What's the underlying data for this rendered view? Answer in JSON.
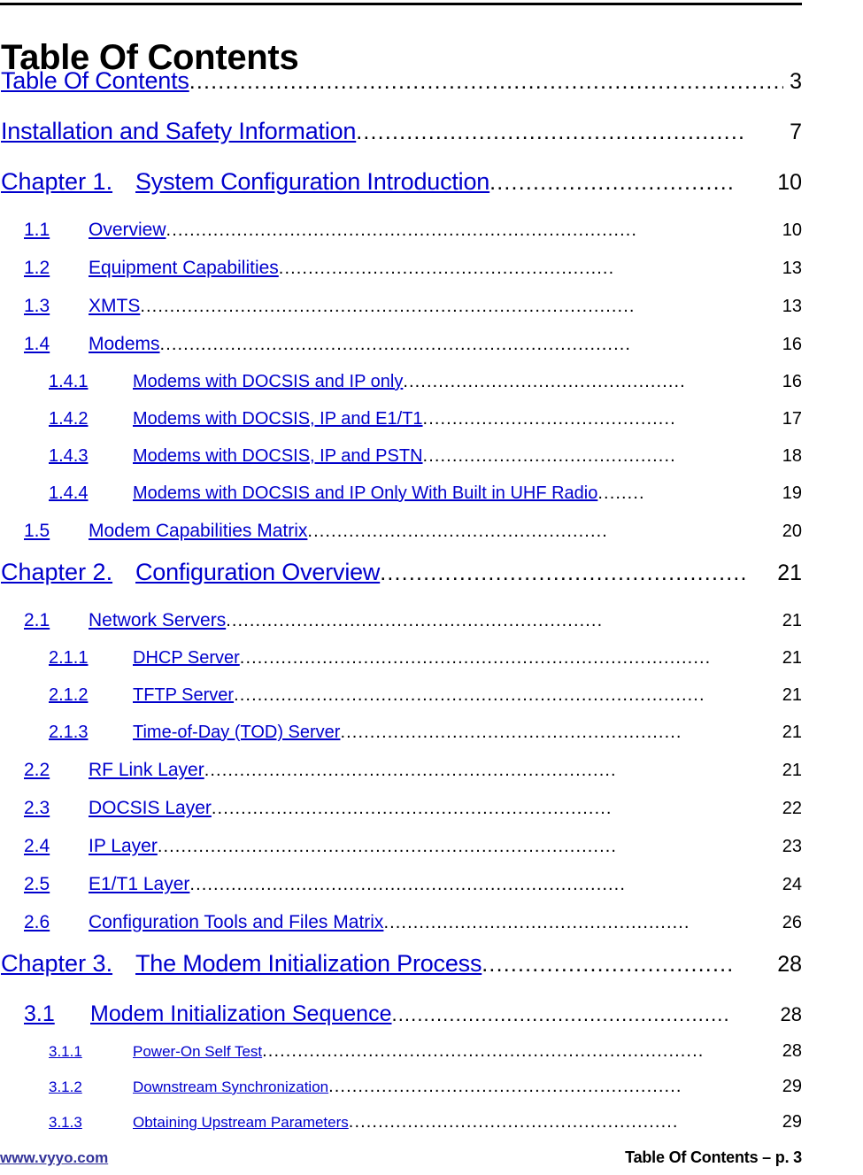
{
  "document": {
    "title": "Table Of Contents",
    "link_color": "#0000cc",
    "footer_url_color": "#333399",
    "text_color": "#000000"
  },
  "toc": {
    "entries": [
      {
        "level": "top",
        "number": "",
        "title": "Table Of Contents",
        "leader": "....................................................................................",
        "page": "3"
      },
      {
        "level": "top",
        "number": "",
        "title": "Installation and Safety Information ",
        "leader": "......................................................",
        "page": "7"
      },
      {
        "level": "chapter",
        "number": "Chapter 1.",
        "title": "System Configuration Introduction",
        "leader": "..................................",
        "page": "10"
      },
      {
        "level": "sub1",
        "number": "1.1",
        "title": "Overview",
        "leader": "................................................................................",
        "page": "10"
      },
      {
        "level": "sub1",
        "number": "1.2",
        "title": "Equipment Capabilities ",
        "leader": ".........................................................",
        "page": "13"
      },
      {
        "level": "sub1",
        "number": "1.3",
        "title": "XMTS",
        "leader": "....................................................................................",
        "page": "13"
      },
      {
        "level": "sub1",
        "number": "1.4",
        "title": "Modems",
        "leader": "................................................................................",
        "page": "16"
      },
      {
        "level": "sub2",
        "number": "1.4.1",
        "title": "Modems with DOCSIS and IP only",
        "leader": "................................................",
        "page": "16"
      },
      {
        "level": "sub2",
        "number": "1.4.2",
        "title": "Modems with DOCSIS, IP and E1/T1",
        "leader": "...........................................",
        "page": "17"
      },
      {
        "level": "sub2",
        "number": "1.4.3",
        "title": "Modems with DOCSIS, IP and PSTN",
        "leader": "...........................................",
        "page": "18"
      },
      {
        "level": "sub2",
        "number": "1.4.4",
        "title": "Modems with DOCSIS and IP Only With Built in UHF Radio ",
        "leader": "........",
        "page": "19"
      },
      {
        "level": "sub1",
        "number": "1.5",
        "title": "Modem Capabilities Matrix ",
        "leader": "...................................................",
        "page": "20"
      },
      {
        "level": "chapter",
        "number": "Chapter 2.",
        "title": "Configuration Overview",
        "leader": "...................................................",
        "page": "21"
      },
      {
        "level": "sub1",
        "number": "2.1",
        "title": "Network Servers ",
        "leader": "................................................................",
        "page": "21"
      },
      {
        "level": "sub2",
        "number": "2.1.1",
        "title": "DHCP Server",
        "leader": "................................................................................",
        "page": "21"
      },
      {
        "level": "sub2",
        "number": "2.1.2",
        "title": "TFTP Server",
        "leader": "................................................................................",
        "page": "21"
      },
      {
        "level": "sub2",
        "number": "2.1.3",
        "title": "Time-of-Day (TOD) Server ",
        "leader": "..........................................................",
        "page": "21"
      },
      {
        "level": "sub1",
        "number": "2.2",
        "title": "RF Link Layer ",
        "leader": "......................................................................",
        "page": "21"
      },
      {
        "level": "sub1",
        "number": "2.3",
        "title": "DOCSIS Layer",
        "leader": "....................................................................",
        "page": "22"
      },
      {
        "level": "sub1",
        "number": "2.4",
        "title": "IP Layer ",
        "leader": "..............................................................................",
        "page": "23"
      },
      {
        "level": "sub1",
        "number": "2.5",
        "title": "E1/T1 Layer ",
        "leader": "..........................................................................",
        "page": "24"
      },
      {
        "level": "sub1",
        "number": "2.6",
        "title": "Configuration Tools and Files Matrix ",
        "leader": "....................................................",
        "page": "26"
      },
      {
        "level": "chapter",
        "number": "Chapter 3.",
        "title": "The Modem Initialization Process",
        "leader": "...................................",
        "page": "28"
      },
      {
        "level": "sub1-big",
        "number": "3.1",
        "title": "Modem Initialization Sequence",
        "leader": ".....................................................",
        "page": "28"
      },
      {
        "level": "sub2-small",
        "number": "3.1.1",
        "title": "Power-On Self Test ",
        "leader": "...........................................................................",
        "page": "28"
      },
      {
        "level": "sub2-small",
        "number": "3.1.2",
        "title": "Downstream Synchronization",
        "leader": "............................................................",
        "page": "29"
      },
      {
        "level": "sub2-small",
        "number": "3.1.3",
        "title": "Obtaining Upstream Parameters ",
        "leader": "........................................................",
        "page": "29"
      }
    ]
  },
  "footer": {
    "url": "www.vyyo.com",
    "label": "Table Of Contents – p. 3"
  }
}
